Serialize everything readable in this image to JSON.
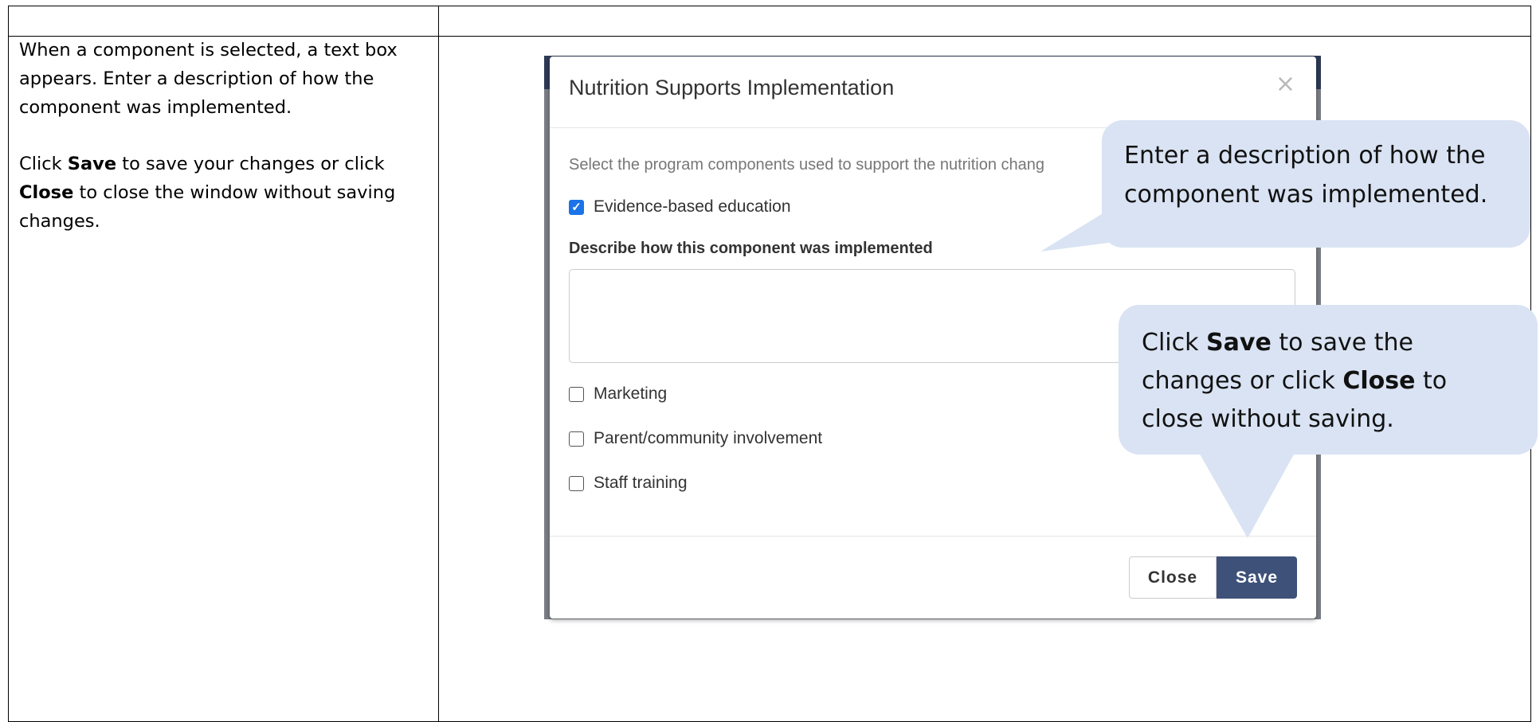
{
  "instructions": {
    "para1": "When a component is selected, a text box appears. Enter a description of how the component was implemented.",
    "para2_prefix": "Click ",
    "para2_save": "Save",
    "para2_middle": " to save your changes or click ",
    "para2_close": "Close",
    "para2_suffix": " to close the window without saving changes."
  },
  "modal": {
    "title": "Nutrition Supports Implementation",
    "close_icon": "×",
    "prompt": "Select the program components used to support the nutrition chang",
    "components": [
      {
        "label": "Evidence-based education",
        "checked": true
      },
      {
        "label": "Marketing",
        "checked": false
      },
      {
        "label": "Parent/community involvement",
        "checked": false
      },
      {
        "label": "Staff training",
        "checked": false
      }
    ],
    "description_label": "Describe how this component was implemented",
    "description_value": "",
    "close_button": "Close",
    "save_button": "Save"
  },
  "callouts": {
    "callout1": "Enter a description of how the component was implemented.",
    "callout2_prefix": "Click ",
    "callout2_save": "Save",
    "callout2_middle": " to save the changes or click ",
    "callout2_close": "Close",
    "callout2_suffix": " to close without saving."
  },
  "colors": {
    "callout_fill": "#d9e3f3",
    "save_button": "#3e5179",
    "checkbox_checked": "#1a73e8"
  }
}
